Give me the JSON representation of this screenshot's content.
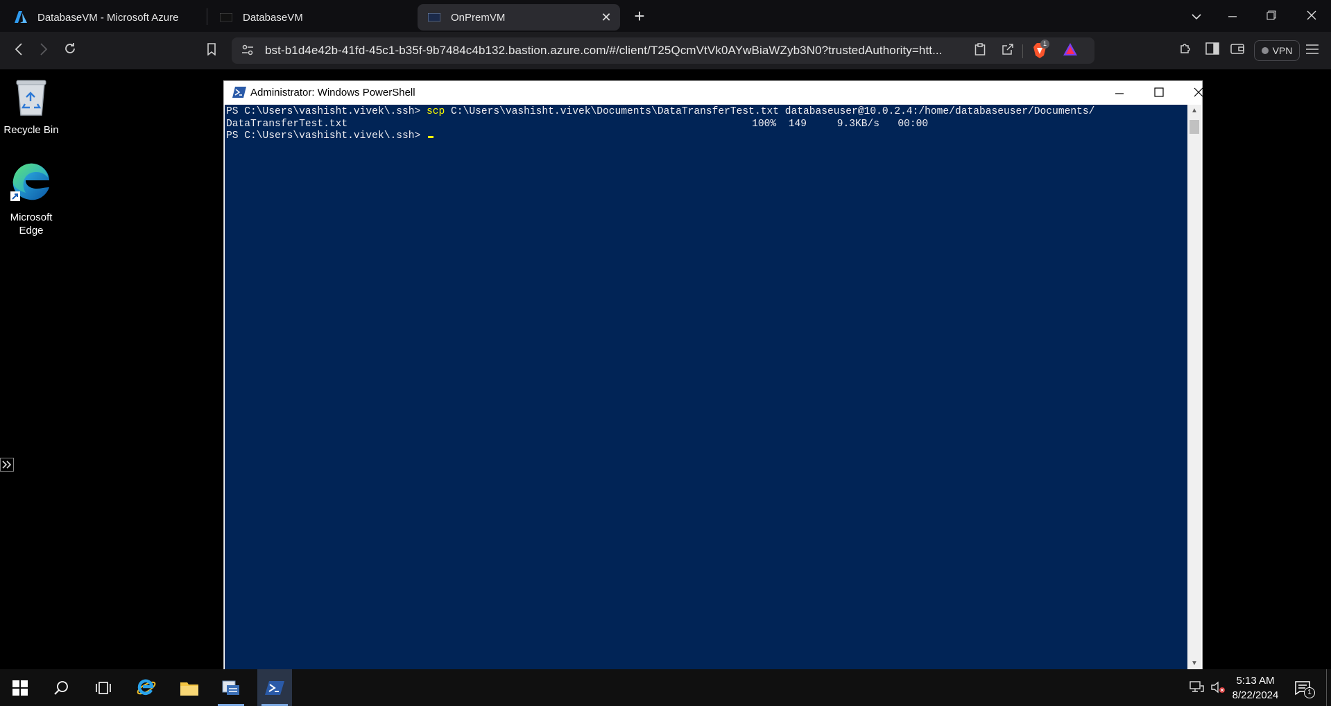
{
  "browser": {
    "tabs": [
      {
        "title": "DatabaseVM - Microsoft Azure",
        "icon": "azure-logo-icon",
        "active": false
      },
      {
        "title": "DatabaseVM",
        "icon": "terminal-tab-icon",
        "active": false
      },
      {
        "title": "OnPremVM",
        "icon": "terminal-tab-icon",
        "active": true
      }
    ],
    "url": "bst-b1d4e42b-41fd-45c1-b35f-9b7484c4b132.bastion.azure.com/#/client/T25QcmVtVk0AYwBiaWZyb3N0?trustedAuthority=htt...",
    "shields_badge": "1",
    "vpn_label": "VPN"
  },
  "desktop": {
    "icons": [
      {
        "label": "Recycle Bin"
      },
      {
        "label": "Microsoft Edge"
      }
    ]
  },
  "powershell": {
    "title": "Administrator: Windows PowerShell",
    "lines": {
      "l1_prompt": "PS C:\\Users\\vashisht.vivek\\.ssh> ",
      "l1_cmd": "scp",
      "l1_args": " C:\\Users\\vashisht.vivek\\Documents\\DataTransferTest.txt databaseuser@10.0.2.4:/home/databaseuser/Documents/",
      "l2_file": "DataTransferTest.txt",
      "l2_progress": "100%  149     9.3KB/s   00:00",
      "l3_prompt": "PS C:\\Users\\vashisht.vivek\\.ssh> "
    }
  },
  "taskbar": {
    "time": "5:13 AM",
    "date": "8/22/2024",
    "notification_count": "1"
  },
  "colors": {
    "console_bg": "#012456",
    "console_fg": "#eeedf0",
    "command_yellow": "#ffff00",
    "active_taskbar": "#2a3548"
  }
}
